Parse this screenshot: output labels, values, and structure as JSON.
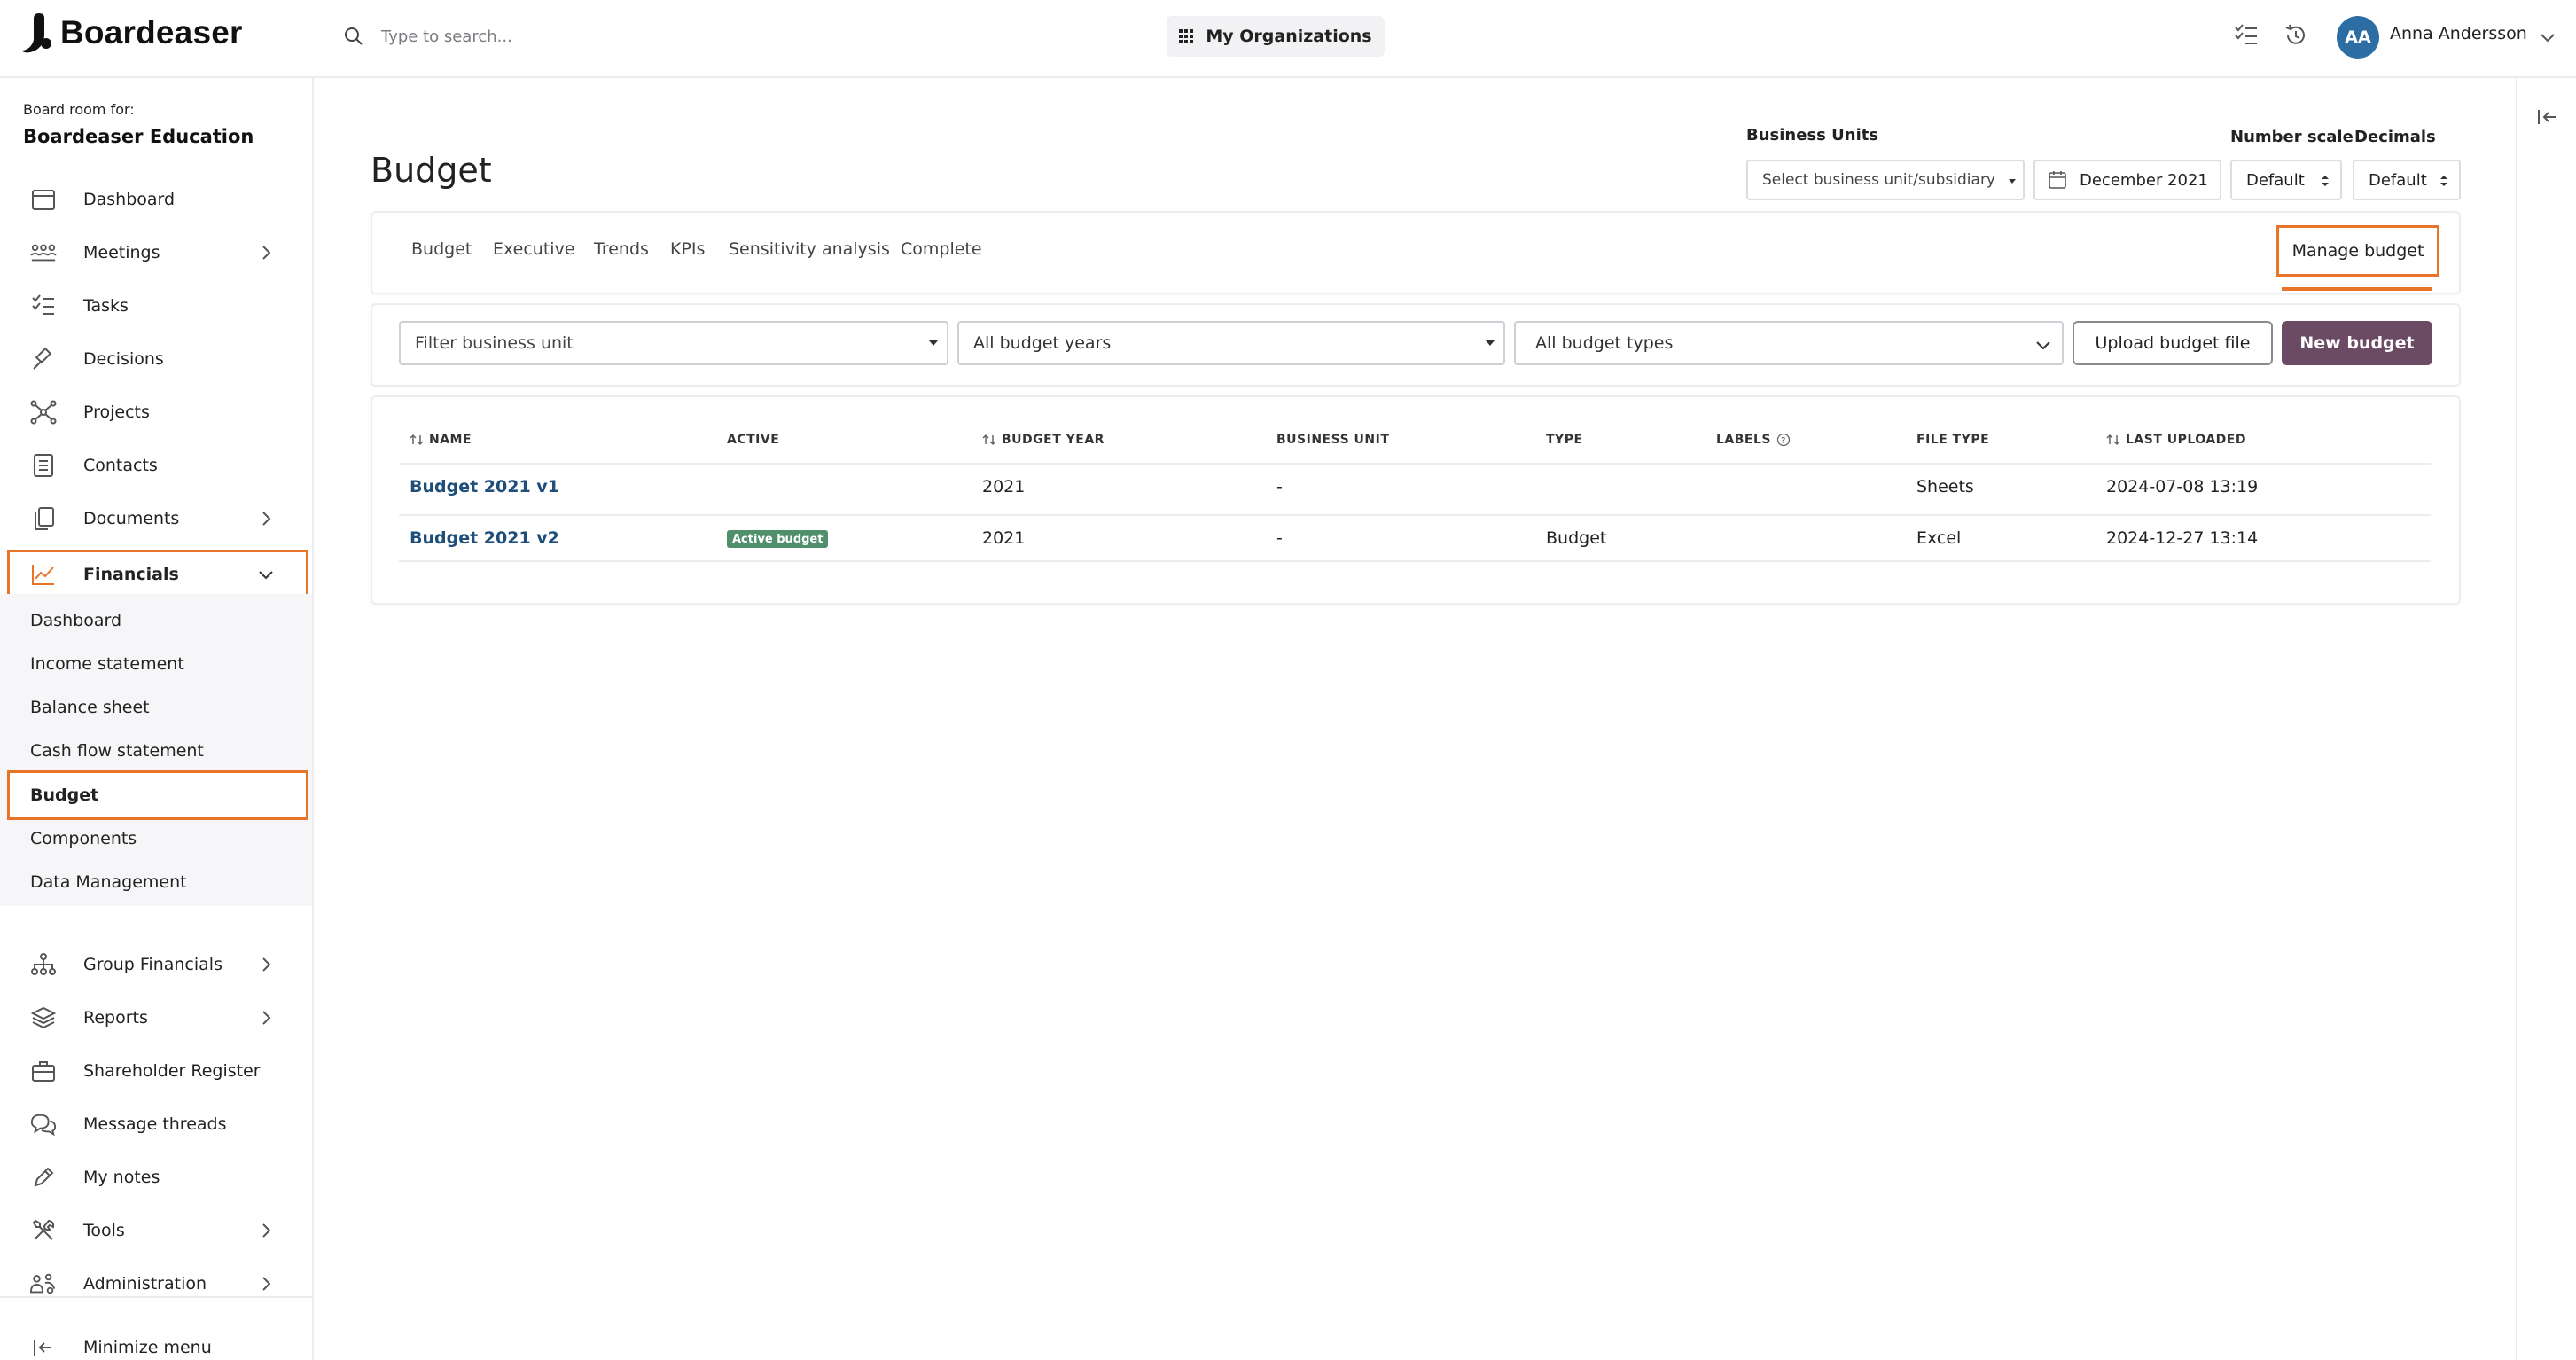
{
  "app": {
    "logo_text": "Boardeaser",
    "search_placeholder": "Type to search...",
    "org_button": "My Organizations",
    "user": {
      "initials": "AA",
      "name": "Anna Andersson"
    },
    "colors": {
      "accent": "#e8742a",
      "primary": "#6b4a64",
      "link": "#1e4e79",
      "avatar": "#2c6ea4",
      "badge": "#4f8f6b"
    }
  },
  "sidebar": {
    "board_label": "Board room for:",
    "board_name": "Boardeaser Education",
    "items": [
      {
        "label": "Dashboard",
        "icon": "calendar-icon"
      },
      {
        "label": "Meetings",
        "icon": "meeting-icon"
      },
      {
        "label": "Tasks",
        "icon": "tasks-icon"
      },
      {
        "label": "Decisions",
        "icon": "gavel-icon"
      },
      {
        "label": "Projects",
        "icon": "network-icon"
      },
      {
        "label": "Contacts",
        "icon": "contacts-icon"
      },
      {
        "label": "Documents",
        "icon": "documents-icon"
      },
      {
        "label": "Financials",
        "icon": "chart-line-icon"
      }
    ],
    "financials_sub": [
      {
        "label": "Dashboard"
      },
      {
        "label": "Income statement"
      },
      {
        "label": "Balance sheet"
      },
      {
        "label": "Cash flow statement"
      },
      {
        "label": "Budget"
      },
      {
        "label": "Components"
      },
      {
        "label": "Data Management"
      }
    ],
    "items_after": [
      {
        "label": "Group Financials",
        "icon": "hierarchy-icon"
      },
      {
        "label": "Reports",
        "icon": "layers-icon"
      },
      {
        "label": "Shareholder Register",
        "icon": "briefcase-icon"
      },
      {
        "label": "Message threads",
        "icon": "chat-icon"
      },
      {
        "label": "My notes",
        "icon": "pencil-icon"
      },
      {
        "label": "Tools",
        "icon": "tools-icon"
      },
      {
        "label": "Administration",
        "icon": "users-icon"
      }
    ],
    "minimize": "Minimize menu"
  },
  "main": {
    "title": "Budget",
    "controls": {
      "business_units_label": "Business Units",
      "business_units_placeholder": "Select business unit/subsidiary",
      "date": "December 2021",
      "number_scale_label": "Number scale",
      "number_scale_value": "Default",
      "decimals_label": "Decimals",
      "decimals_value": "Default"
    },
    "tabs": [
      "Budget",
      "Executive",
      "Trends",
      "KPIs",
      "Sensitivity analysis",
      "Complete"
    ],
    "manage_button": "Manage budget",
    "filters": {
      "business_unit": "Filter business unit",
      "budget_years": "All budget years",
      "budget_types": "All budget types",
      "upload": "Upload budget file",
      "new": "New budget"
    },
    "table": {
      "headers": [
        "NAME",
        "ACTIVE",
        "BUDGET YEAR",
        "BUSINESS UNIT",
        "TYPE",
        "LABELS",
        "FILE TYPE",
        "LAST UPLOADED"
      ],
      "rows": [
        {
          "name": "Budget 2021 v1",
          "active": "",
          "year": "2021",
          "unit": "-",
          "type": "",
          "labels": "",
          "file_type": "Sheets",
          "uploaded": "2024-07-08 13:19"
        },
        {
          "name": "Budget 2021 v2",
          "active": "Active budget",
          "year": "2021",
          "unit": "-",
          "type": "Budget",
          "labels": "",
          "file_type": "Excel",
          "uploaded": "2024-12-27 13:14"
        }
      ]
    }
  }
}
